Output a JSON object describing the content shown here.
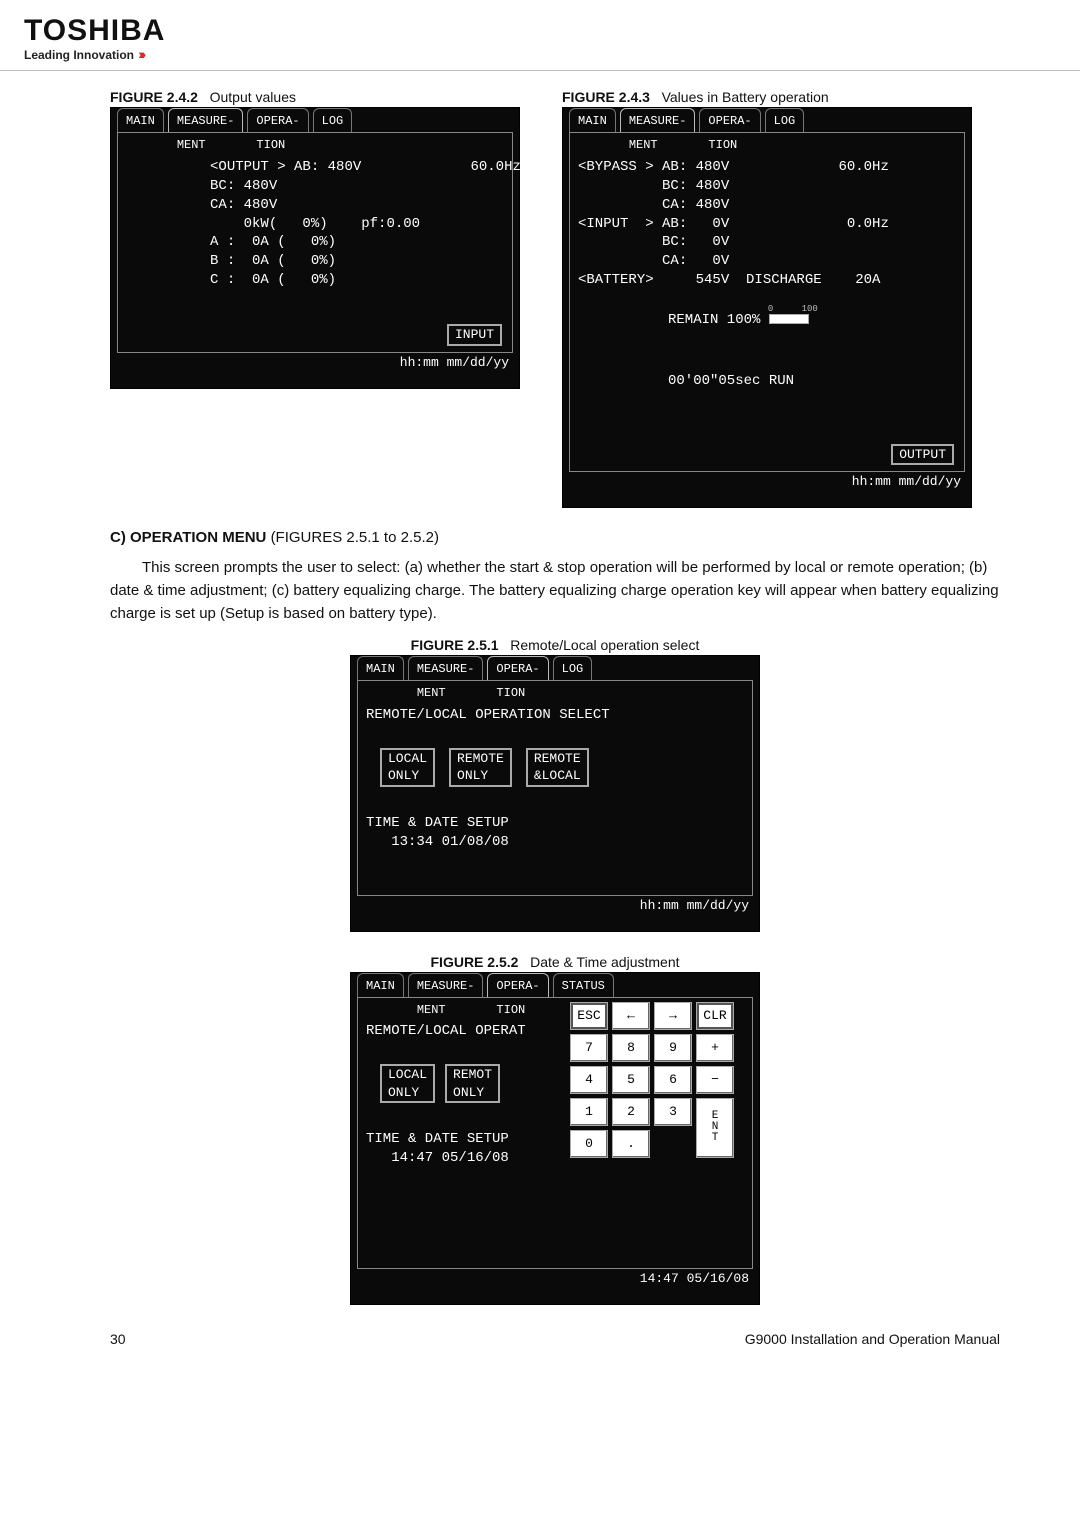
{
  "brand": {
    "name": "TOSHIBA",
    "tagline": "Leading Innovation"
  },
  "figures": {
    "f242": {
      "caption_bold": "FIGURE 2.4.2",
      "caption_rest": "Output values",
      "tabs": {
        "main": "MAIN",
        "measure": "MEASURE-\nMENT",
        "opera": "OPERA-\nTION",
        "log": "LOG"
      },
      "body": "<OUTPUT > AB: 480V             60.0Hz\n          BC: 480V\n          CA: 480V\n              0kW(   0%)    pf:0.00\n          A :  0A (   0%)\n          B :  0A (   0%)\n          C :  0A (   0%)",
      "soft": "INPUT",
      "foot": "hh:mm mm/dd/yy"
    },
    "f243": {
      "caption_bold": "FIGURE 2.4.3",
      "caption_rest": "Values in Battery operation",
      "tabs": {
        "main": "MAIN",
        "measure": "MEASURE-\nMENT",
        "opera": "OPERA-\nTION",
        "log": "LOG"
      },
      "line1": "<BYPASS > AB: 480V             60.0Hz",
      "line2": "          BC: 480V",
      "line3": "          CA: 480V",
      "line4": "<INPUT  > AB:   0V              0.0Hz",
      "line5": "          BC:   0V",
      "line6": "          CA:   0V",
      "line7a": "<BATTERY>     545V  DISCHARGE    20A",
      "remain_label": "REMAIN 100%",
      "gauge_ticks": {
        "lo": "0",
        "hi": "100"
      },
      "gauge_pct": 100,
      "elapsed": "00'00\"05sec RUN",
      "soft": "OUTPUT",
      "foot": "hh:mm mm/dd/yy"
    },
    "f251": {
      "caption_bold": "FIGURE 2.5.1",
      "caption_rest": "Remote/Local operation select",
      "tabs": {
        "main": "MAIN",
        "measure": "MEASURE-\nMENT",
        "opera": "OPERA-\nTION",
        "log": "LOG"
      },
      "title": "REMOTE/LOCAL OPERATION SELECT",
      "buttons": {
        "local": "LOCAL\nONLY",
        "remote": "REMOTE\nONLY",
        "both": "REMOTE\n&LOCAL"
      },
      "sub_title": "TIME & DATE SETUP",
      "datetime": "   13:34 01/08/08",
      "foot": "hh:mm mm/dd/yy"
    },
    "f252": {
      "caption_bold": "FIGURE 2.5.2",
      "caption_rest": "Date & Time adjustment",
      "tabs": {
        "main": "MAIN",
        "measure": "MEASURE-\nMENT",
        "opera": "OPERA-\nTION",
        "status": "STATUS"
      },
      "title": "REMOTE/LOCAL OPERAT",
      "buttons": {
        "local": "LOCAL\nONLY",
        "remot": "REMOT\nONLY"
      },
      "sub_title": "TIME & DATE SETUP",
      "datetime": "   14:47 05/16/08",
      "keys": {
        "esc": "ESC",
        "left": "←",
        "right": "→",
        "clr": "CLR",
        "k7": "7",
        "k8": "8",
        "k9": "9",
        "plus": "+",
        "k4": "4",
        "k5": "5",
        "k6": "6",
        "minus": "−",
        "k1": "1",
        "k2": "2",
        "k3": "3",
        "k0": "0",
        "dot": ".",
        "ent": "E\nN\nT"
      },
      "status_line": "14:47 05/16/08"
    }
  },
  "section_c": {
    "heading": "C)    OPERATION MENU",
    "heading_ref": " (FIGURES 2.5.1 to 2.5.2)",
    "body": "This screen prompts the user to select: (a) whether the start & stop operation will be performed by local or remote operation; (b) date & time adjustment; (c) battery equalizing charge. The battery equalizing charge operation key will appear when battery equalizing charge is set up (Setup is based on battery type)."
  },
  "footer": {
    "page": "30",
    "doc": "G9000 Installation and Operation Manual"
  }
}
